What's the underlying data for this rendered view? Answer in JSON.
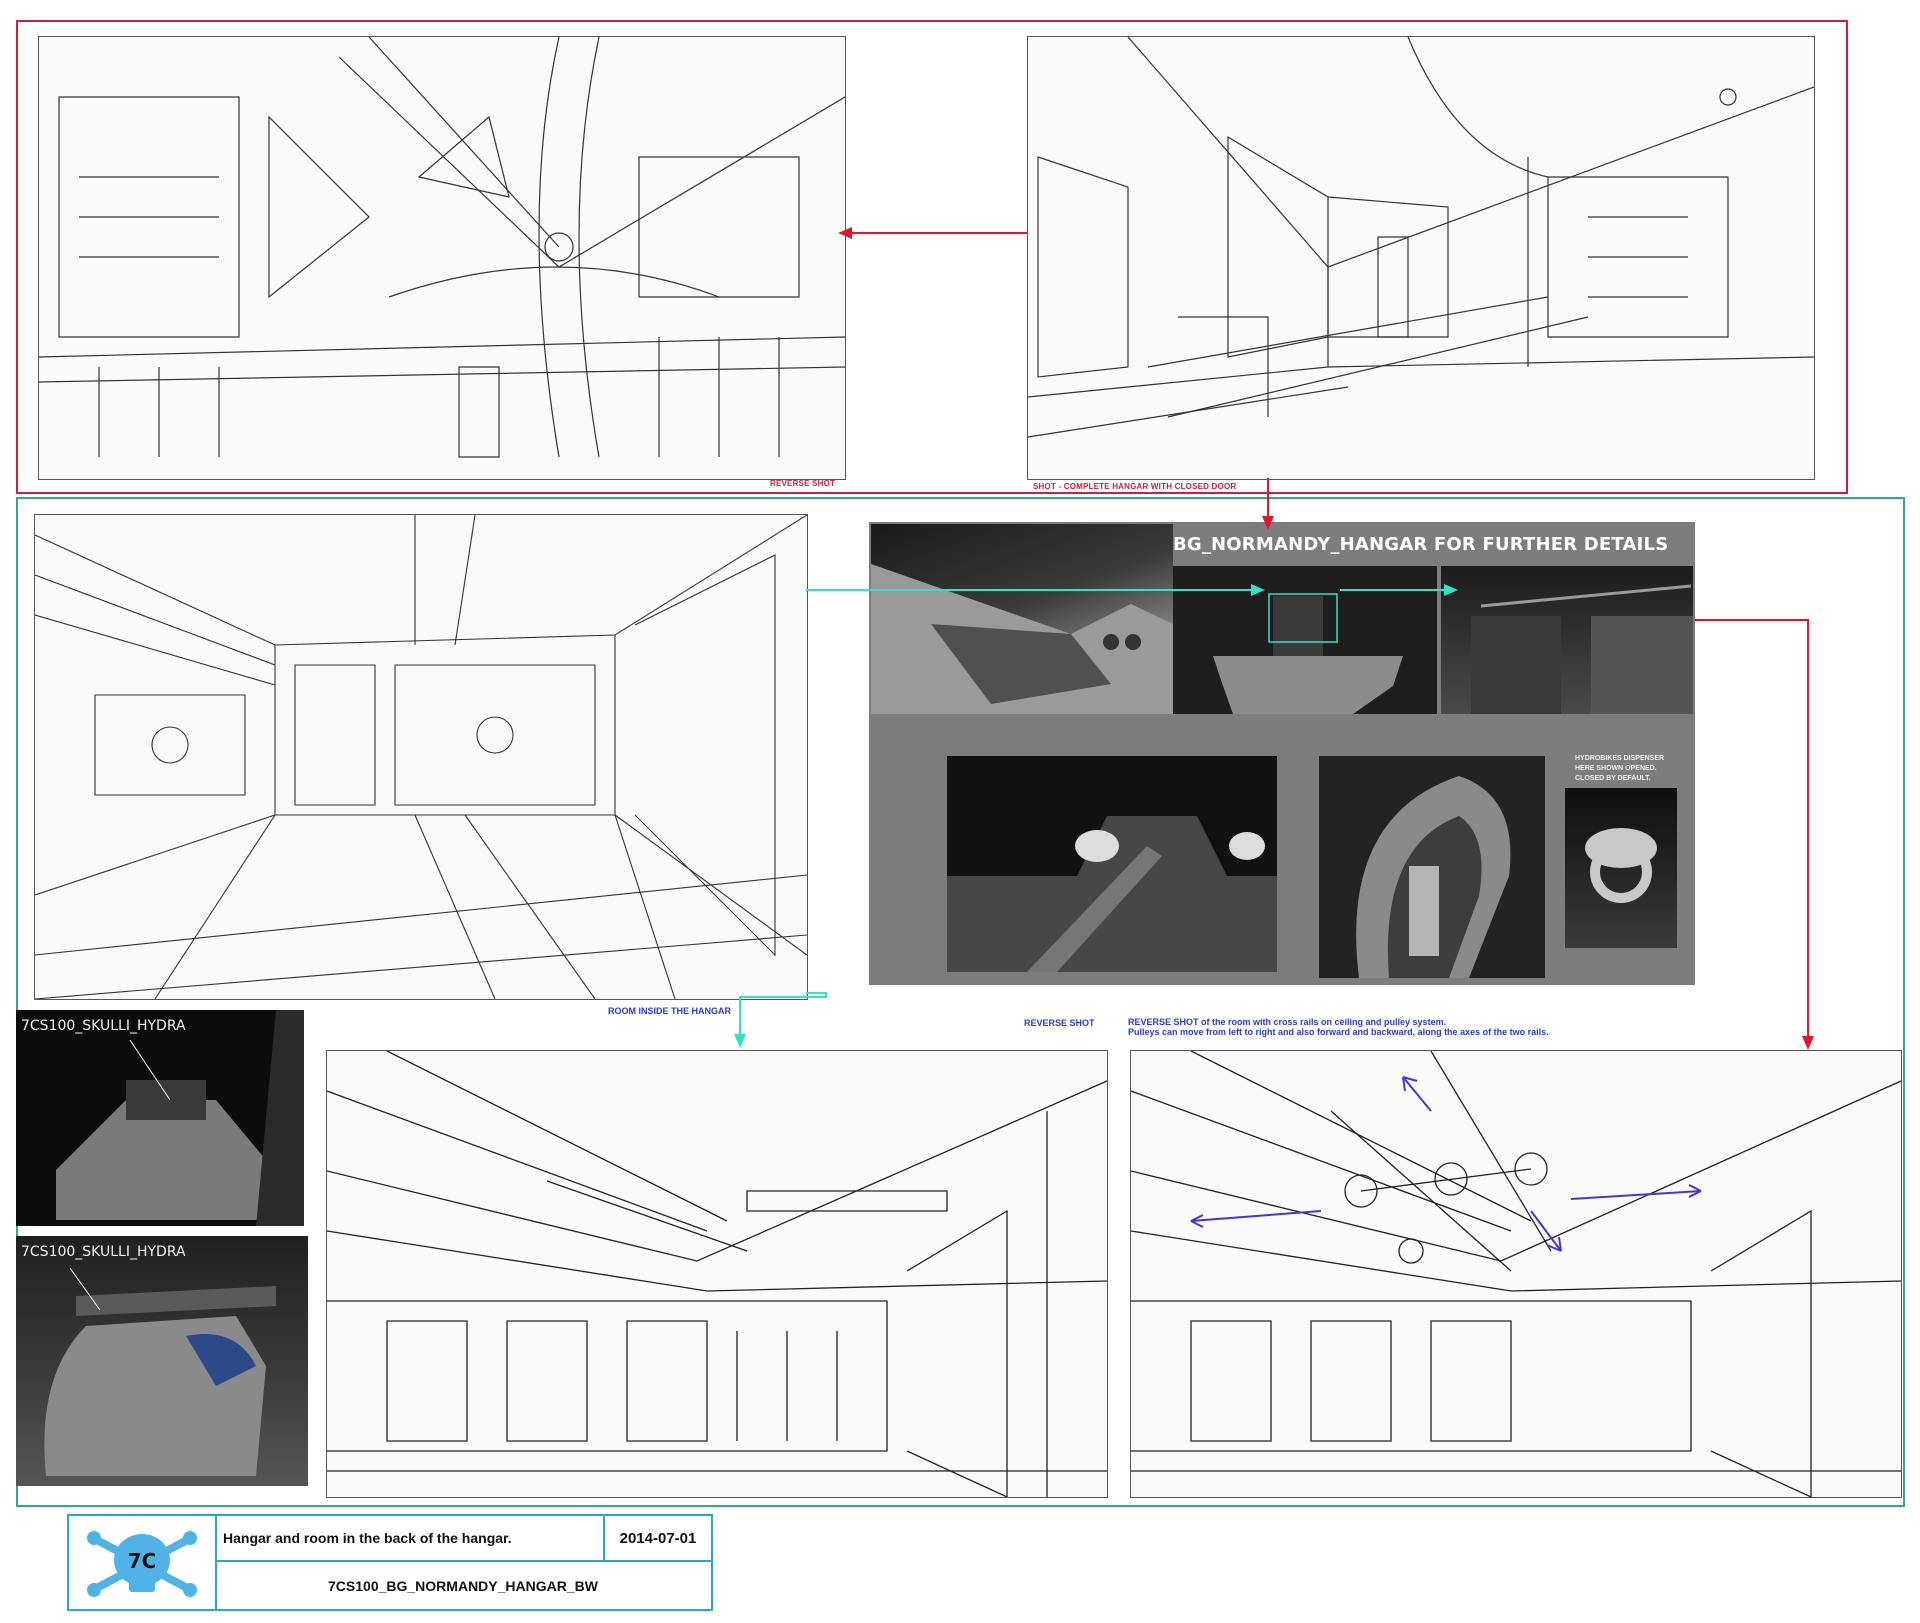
{
  "labels": {
    "reverse_shot_top": "REVERSE SHOT",
    "shot_complete_hangar": "SHOT - COMPLETE HANGAR WITH CLOSED DOOR",
    "room_inside_hangar": "ROOM INSIDE THE HANGAR",
    "reverse_shot_mid": "REVERSE SHOT",
    "reverse_shot_desc_line1": "REVERSE SHOT of the room with cross rails on ceiling and pulley system.",
    "reverse_shot_desc_line2": "Pulleys can move from left to right and also forward and backward, along the axes of the two rails."
  },
  "render_panel": {
    "header": "PLEASE REFER TO 7CS100_BG_NORMANDY_HANGAR FOR FURTHER DETAILS",
    "dispenser_note_line1": "HYDROBIKES DISPENSER",
    "dispenser_note_line2": "HERE SHOWN OPENED.",
    "dispenser_note_line3": "CLOSED BY DEFAULT."
  },
  "models": [
    {
      "label": "7CS100_SKULLI_HYDRA"
    },
    {
      "label": "7CS100_SKULLI_HYDRA"
    }
  ],
  "title_block": {
    "description": "Hangar and room in the back of the hangar.",
    "date": "2014-07-01",
    "filename": "7CS100_BG_NORMANDY_HANGAR_BW",
    "logo_text": "7C"
  },
  "colors": {
    "frame_red": "#c8213b",
    "frame_teal": "#2fa88e",
    "arrow_cyan": "#34e0c8",
    "annotation_blue": "#2b3bd0",
    "title_block_border": "#2ea3d8",
    "logo_blue": "#4fb3e8"
  }
}
